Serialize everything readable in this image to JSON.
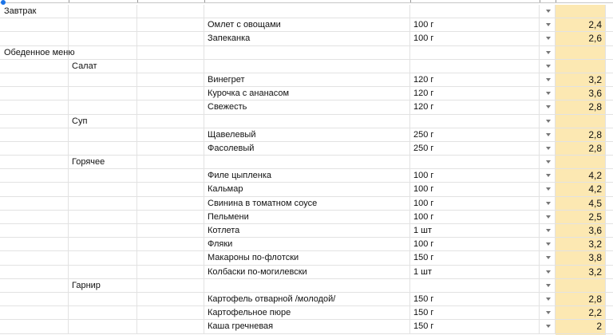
{
  "sheet": {
    "colors": {
      "price_column_fill": "#fce8b2",
      "grid_line": "#e2e2e2",
      "selection_handle": "#1a73e8"
    },
    "rows": [
      {
        "section": "Завтрак",
        "category": "",
        "item": "",
        "portion": "",
        "price": "",
        "has_dropdown": true
      },
      {
        "section": "",
        "category": "",
        "item": "Омлет с овощами",
        "portion": "100 г",
        "price": "2,4",
        "has_dropdown": true
      },
      {
        "section": "",
        "category": "",
        "item": "Запеканка",
        "portion": "100 г",
        "price": "2,6",
        "has_dropdown": true
      },
      {
        "section": "Обеденное меню",
        "category": "",
        "item": "",
        "portion": "",
        "price": "",
        "has_dropdown": true
      },
      {
        "section": "",
        "category": "Салат",
        "item": "",
        "portion": "",
        "price": "",
        "has_dropdown": true
      },
      {
        "section": "",
        "category": "",
        "item": "Винегрет",
        "portion": "120 г",
        "price": "3,2",
        "has_dropdown": true
      },
      {
        "section": "",
        "category": "",
        "item": "Курочка с ананасом",
        "portion": "120 г",
        "price": "3,6",
        "has_dropdown": true
      },
      {
        "section": "",
        "category": "",
        "item": "Свежесть",
        "portion": "120 г",
        "price": "2,8",
        "has_dropdown": true
      },
      {
        "section": "",
        "category": "Суп",
        "item": "",
        "portion": "",
        "price": "",
        "has_dropdown": true
      },
      {
        "section": "",
        "category": "",
        "item": "Щавелевый",
        "portion": "250 г",
        "price": "2,8",
        "has_dropdown": true
      },
      {
        "section": "",
        "category": "",
        "item": "Фасолевый",
        "portion": "250 г",
        "price": "2,8",
        "has_dropdown": true
      },
      {
        "section": "",
        "category": "Горячее",
        "item": "",
        "portion": "",
        "price": "",
        "has_dropdown": true
      },
      {
        "section": "",
        "category": "",
        "item": "Филе цыпленка",
        "portion": "100 г",
        "price": "4,2",
        "has_dropdown": true
      },
      {
        "section": "",
        "category": "",
        "item": "Кальмар",
        "portion": "100 г",
        "price": "4,2",
        "has_dropdown": true
      },
      {
        "section": "",
        "category": "",
        "item": "Свинина в томатном соусе",
        "portion": "100 г",
        "price": "4,5",
        "has_dropdown": true
      },
      {
        "section": "",
        "category": "",
        "item": "Пельмени",
        "portion": "100 г",
        "price": "2,5",
        "has_dropdown": true
      },
      {
        "section": "",
        "category": "",
        "item": "Котлета",
        "portion": "1 шт",
        "price": "3,6",
        "has_dropdown": true
      },
      {
        "section": "",
        "category": "",
        "item": "Фляки",
        "portion": "100 г",
        "price": "3,2",
        "has_dropdown": true
      },
      {
        "section": "",
        "category": "",
        "item": "Макароны по-флотски",
        "portion": "150 г",
        "price": "3,8",
        "has_dropdown": true
      },
      {
        "section": "",
        "category": "",
        "item": "Колбаски по-могилевски",
        "portion": "1 шт",
        "price": "3,2",
        "has_dropdown": true
      },
      {
        "section": "",
        "category": "Гарнир",
        "item": "",
        "portion": "",
        "price": "",
        "has_dropdown": true
      },
      {
        "section": "",
        "category": "",
        "item": "Картофель отварной /молодой/",
        "portion": "150 г",
        "price": "2,8",
        "has_dropdown": true
      },
      {
        "section": "",
        "category": "",
        "item": "Картофельное пюре",
        "portion": "150 г",
        "price": "2,2",
        "has_dropdown": true
      },
      {
        "section": "",
        "category": "",
        "item": "Каша гречневая",
        "portion": "150 г",
        "price": "2",
        "has_dropdown": true
      }
    ]
  }
}
